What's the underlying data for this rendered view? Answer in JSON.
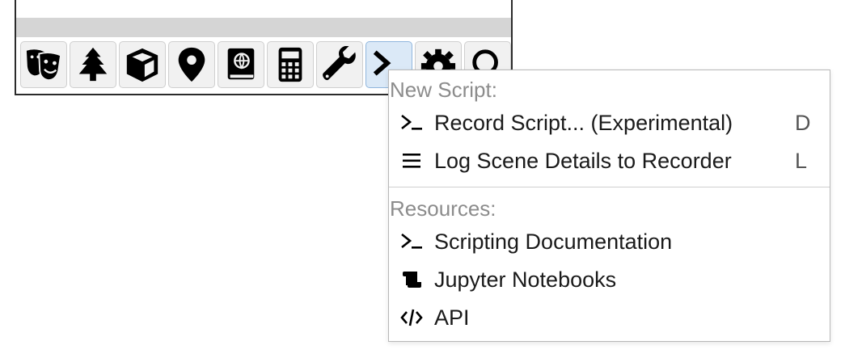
{
  "toolbar": {
    "buttons": [
      {
        "icon": "theater-masks-icon",
        "active": false
      },
      {
        "icon": "tree-icon",
        "active": false
      },
      {
        "icon": "cube-icon",
        "active": false
      },
      {
        "icon": "map-marker-icon",
        "active": false
      },
      {
        "icon": "atlas-book-icon",
        "active": false
      },
      {
        "icon": "calculator-icon",
        "active": false
      },
      {
        "icon": "wrench-icon",
        "active": false
      },
      {
        "icon": "terminal-icon",
        "active": true
      },
      {
        "icon": "gear-icon",
        "active": false
      },
      {
        "icon": "search-icon",
        "active": false
      }
    ]
  },
  "menu": {
    "new_script_label": "New Script:",
    "resources_label": "Resources:",
    "new_script_items": [
      {
        "label": "Record Script... (Experimental)",
        "shortcut": "D",
        "icon": "terminal-icon"
      },
      {
        "label": "Log Scene Details to Recorder",
        "shortcut": "L",
        "icon": "bars-icon"
      }
    ],
    "resource_items": [
      {
        "label": "Scripting Documentation",
        "icon": "terminal-icon"
      },
      {
        "label": "Jupyter Notebooks",
        "icon": "scroll-icon"
      },
      {
        "label": "API",
        "icon": "code-icon"
      }
    ]
  },
  "colors": {
    "active_button": "#dbe9f7",
    "section_label": "#8c8c8c",
    "menu_text": "#1a1a1a"
  }
}
